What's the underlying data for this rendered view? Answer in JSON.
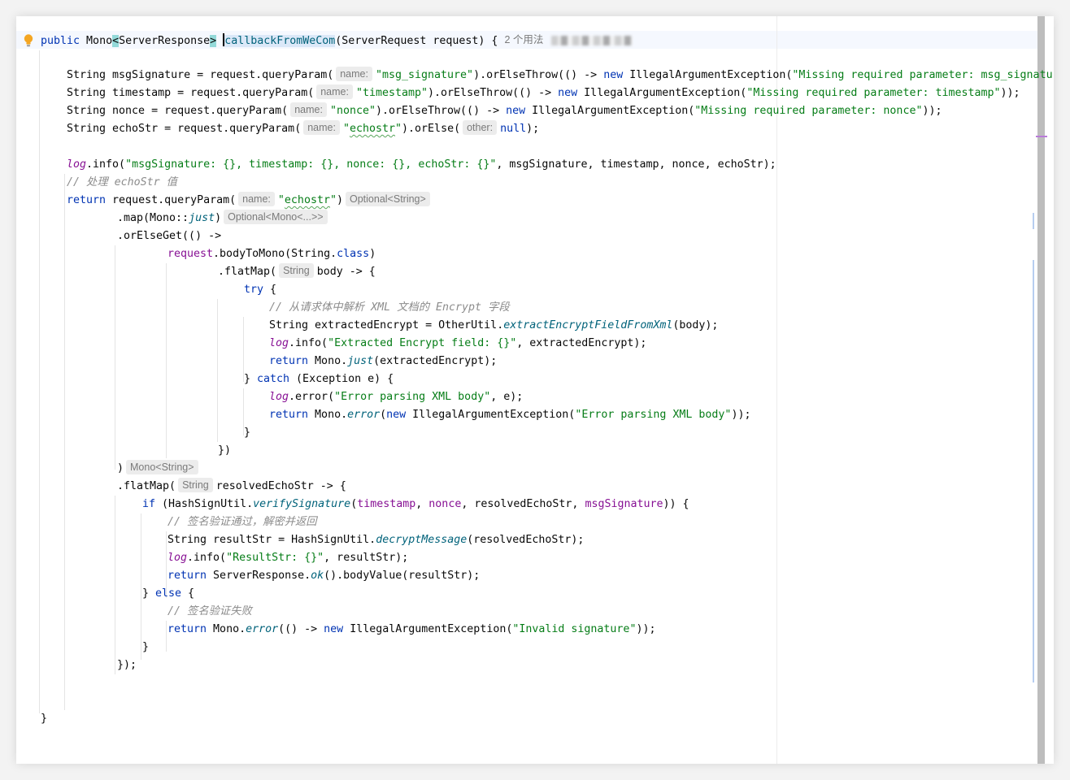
{
  "editor": {
    "usages_hint": "2 个用法",
    "colors": {
      "keyword": "#0033b3",
      "string": "#067d17",
      "field": "#871094",
      "comment": "#8c8c8c",
      "static_method": "#00627a",
      "hint_background": "#ececec",
      "selection_match": "#93d9d9"
    },
    "icons": [
      "lightbulb-icon"
    ],
    "lines": {
      "l1": {
        "kw1": "public",
        "t1": " Mono",
        "lt": "<",
        "t2": "ServerResponse",
        "gt": ">",
        "method": "callbackFromWeCom",
        "t3": "(ServerRequest request) {"
      },
      "l2": {
        "t1": "String msgSignature = request.queryParam(",
        "hint": "name:",
        "s1": "\"msg_signature\"",
        "t2": ").orElseThrow(() -> ",
        "kw1": "new",
        "t3": " IllegalArgumentException(",
        "s2": "\"Missing required parameter: msg_signature\"",
        "t4": ")"
      },
      "l3": {
        "t1": "String timestamp = request.queryParam(",
        "hint": "name:",
        "s1": "\"timestamp\"",
        "t2": ").orElseThrow(() -> ",
        "kw1": "new",
        "t3": " IllegalArgumentException(",
        "s2": "\"Missing required parameter: timestamp\"",
        "t4": "));"
      },
      "l4": {
        "t1": "String nonce = request.queryParam(",
        "hint": "name:",
        "s1": "\"nonce\"",
        "t2": ").orElseThrow(() -> ",
        "kw1": "new",
        "t3": " IllegalArgumentException(",
        "s2": "\"Missing required parameter: nonce\"",
        "t4": "));"
      },
      "l5": {
        "t1": "String echoStr = request.queryParam(",
        "hint1": "name:",
        "q1": "\"",
        "s1": "echostr",
        "q2": "\"",
        "t2": ").orElse(",
        "hint2": "other:",
        "kw1": "null",
        "t3": ");"
      },
      "l6": {
        "f1": "log",
        "t1": ".info(",
        "s1": "\"msgSignature: {}, timestamp: {}, nonce: {}, echoStr: {}\"",
        "t2": ", msgSignature, timestamp, nonce, echoStr);"
      },
      "l7": {
        "c1": "// 处理 echoStr 值"
      },
      "l8": {
        "kw1": "return",
        "t1": " request.queryParam(",
        "hint1": "name:",
        "q1": "\"",
        "s1": "echostr",
        "q2": "\"",
        "t2": ")",
        "hint2": "Optional<String>"
      },
      "l9": {
        "t1": ".map(Mono::",
        "sm1": "just",
        "t2": ")",
        "hint": "Optional<Mono<...>>"
      },
      "l10": {
        "t1": ".orElseGet(() ->"
      },
      "l11": {
        "f1": "request",
        "t1": ".bodyToMono(String.",
        "kw1": "class",
        "t2": ")"
      },
      "l12": {
        "t1": ".flatMap(",
        "hint": "String",
        "t2": "body -> {"
      },
      "l13": {
        "kw1": "try",
        "t1": " {"
      },
      "l14": {
        "c1": "// 从请求体中解析 XML 文档的 Encrypt 字段"
      },
      "l15": {
        "t1": "String extractedEncrypt = OtherUtil.",
        "sm1": "extractEncryptFieldFromXml",
        "t2": "(body);"
      },
      "l16": {
        "f1": "log",
        "t1": ".info(",
        "s1": "\"Extracted Encrypt field: {}\"",
        "t2": ", extractedEncrypt);"
      },
      "l17": {
        "kw1": "return",
        "t1": " Mono.",
        "sm1": "just",
        "t2": "(extractedEncrypt);"
      },
      "l18": {
        "t1": "} ",
        "kw1": "catch",
        "t2": " (Exception e) {"
      },
      "l19": {
        "f1": "log",
        "t1": ".error(",
        "s1": "\"Error parsing XML body\"",
        "t2": ", e);"
      },
      "l20": {
        "kw1": "return",
        "t1": " Mono.",
        "sm1": "error",
        "t2": "(",
        "kw2": "new",
        "t3": " IllegalArgumentException(",
        "s1": "\"Error parsing XML body\"",
        "t4": "));"
      },
      "l21": {
        "t1": "}"
      },
      "l22": {
        "t1": "})"
      },
      "l23": {
        "t1": ")",
        "hint": "Mono<String>"
      },
      "l24": {
        "t1": ".flatMap(",
        "hint": "String",
        "t2": "resolvedEchoStr -> {"
      },
      "l25": {
        "kw1": "if",
        "t1": " (HashSignUtil.",
        "sm1": "verifySignature",
        "t2": "(",
        "f1": "timestamp",
        "t3": ", ",
        "f2": "nonce",
        "t4": ", resolvedEchoStr, ",
        "f3": "msgSignature",
        "t5": ")) {"
      },
      "l26": {
        "c1": "// 签名验证通过，解密并返回"
      },
      "l27": {
        "t1": "String resultStr = HashSignUtil.",
        "sm1": "decryptMessage",
        "t2": "(resolvedEchoStr);"
      },
      "l28": {
        "f1": "log",
        "t1": ".info(",
        "s1": "\"ResultStr: {}\"",
        "t2": ", resultStr);"
      },
      "l29": {
        "kw1": "return",
        "t1": " ServerResponse.",
        "sm1": "ok",
        "t2": "().bodyValue(resultStr);"
      },
      "l30": {
        "t1": "} ",
        "kw1": "else",
        "t2": " {"
      },
      "l31": {
        "c1": "// 签名验证失败"
      },
      "l32": {
        "kw1": "return",
        "t1": " Mono.",
        "sm1": "error",
        "t2": "(() -> ",
        "kw2": "new",
        "t3": " IllegalArgumentException(",
        "s1": "\"Invalid signature\"",
        "t4": "));"
      },
      "l33": {
        "t1": "}"
      },
      "l34": {
        "t1": "});"
      },
      "l35": {
        "t1": "}"
      }
    }
  }
}
